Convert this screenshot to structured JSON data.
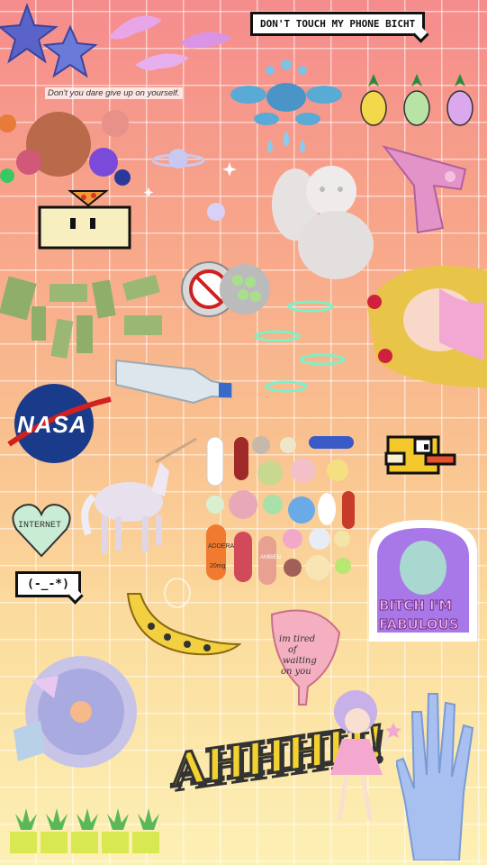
{
  "speech_bubble": "DON'T TOUCH MY PHONE BICHT",
  "caption": "Don't you dare give up on yourself.",
  "nasa_label": "NASA",
  "heart_label": "INTERNET",
  "face_bubble": "(-_-*)",
  "pill_labels": [
    "ADDERALL XR",
    "20mg",
    "AMBIEN"
  ],
  "balloon_text": [
    "im tired",
    "of",
    "waiting",
    "on you"
  ],
  "sticker_line1": "BITCH I'M",
  "sticker_line2": "FABULOUS",
  "scream_text": "AHHHH!",
  "colors": {
    "bg_top": "#f58c8c",
    "bg_bottom": "#fdf0b4",
    "grid": "#ffffff"
  }
}
